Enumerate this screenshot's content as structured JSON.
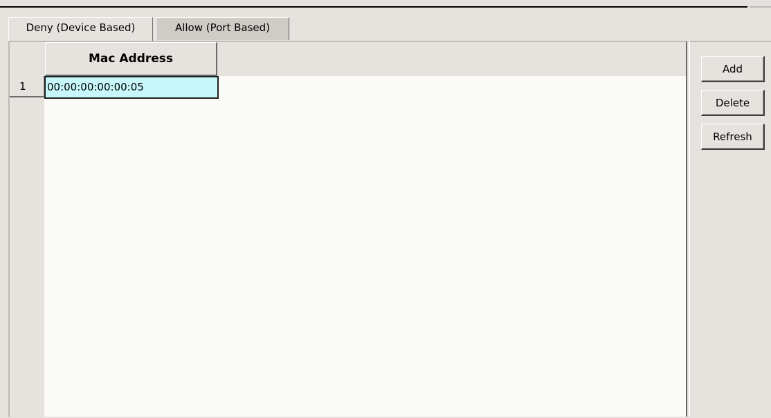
{
  "tabs": [
    {
      "label": "Deny (Device Based)",
      "active": true
    },
    {
      "label": "Allow (Port Based)",
      "active": false
    }
  ],
  "table": {
    "columns": [
      "Mac Address"
    ],
    "rows": [
      {
        "index": "1",
        "mac": "00:00:00:00:00:05",
        "selected": true
      }
    ]
  },
  "buttons": {
    "add": "Add",
    "delete": "Delete",
    "refresh": "Refresh"
  },
  "colors": {
    "selected_cell": "#c7f7fb",
    "background": "#e6e3de",
    "table_body": "#fafaf6"
  }
}
